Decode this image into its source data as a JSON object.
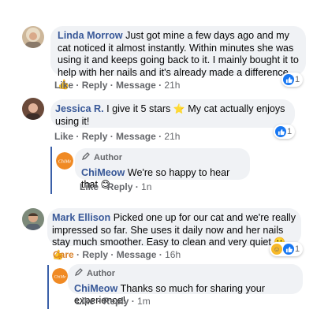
{
  "comments": [
    {
      "name": "Linda Morrow",
      "text": "Just got mine a few days ago and my cat noticed it almost instantly. Within minutes she was using it and keeps going back to it. I mainly bought it to help with her nails and it's already made a difference.",
      "emoji": "👍",
      "actions": {
        "like": "Like",
        "reply": "Reply",
        "message": "Message",
        "time": "21h"
      },
      "reaction_count": "1"
    },
    {
      "name": "Jessica R.",
      "text_before": "I give it 5 stars",
      "star": "⭐",
      "text_after": "My cat actually enjoys using it!",
      "actions": {
        "like": "Like",
        "reply": "Reply",
        "message": "Message",
        "time": "21h"
      },
      "reaction_count": "1",
      "reply": {
        "author_label": "Author",
        "name": "ChiMeow",
        "text": "We're so happy to hear that",
        "emoji": "😊",
        "actions": {
          "like": "Like",
          "reply": "Reply",
          "time": "1n"
        }
      }
    },
    {
      "name": "Mark Ellison",
      "text": "Picked one up for our cat and we're really impressed so far. She uses it daily now and her nails stay much smoother. Easy to clean and very quiet",
      "emoji": "🙂👍",
      "actions": {
        "care": "Care",
        "reply": "Reply",
        "message": "Message",
        "time": "16h"
      },
      "reaction_count": "1",
      "reply": {
        "author_label": "Author",
        "name": "ChiMeow",
        "text": "Thanks so much for sharing your experience!",
        "actions": {
          "like": "Like",
          "reply": "Reply",
          "time": "1m"
        }
      }
    }
  ],
  "colors": {
    "name": "#385898",
    "bubble": "#f0f2f5",
    "like_blue": "#1877f2",
    "care_orange": "#d9822b",
    "thread": "#3a5fa8"
  },
  "icons": [
    "pencil-icon",
    "like-icon",
    "care-icon",
    "brand-logo"
  ]
}
